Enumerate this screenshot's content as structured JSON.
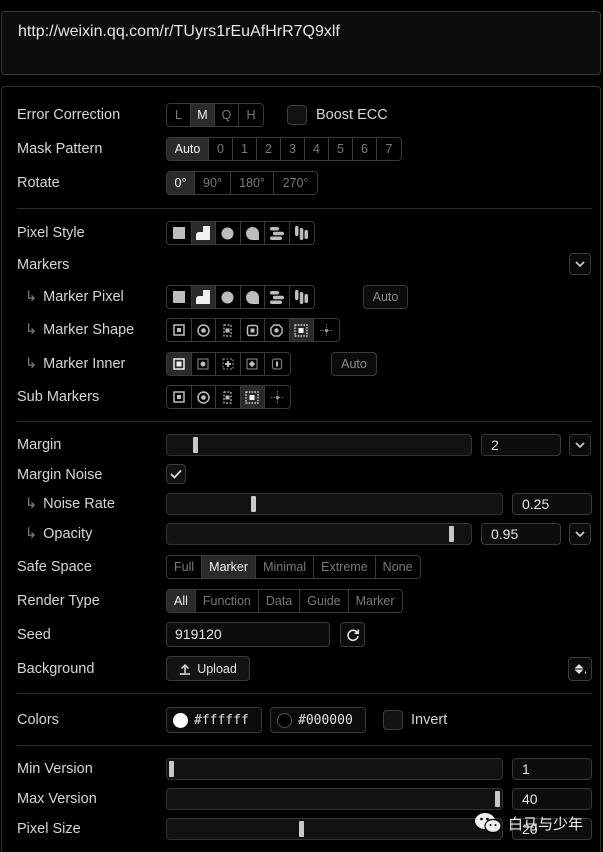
{
  "url": "http://weixin.qq.com/r/TUyrs1rEuAfHrR7Q9xlf",
  "error_correction": {
    "label": "Error Correction",
    "options": [
      "L",
      "M",
      "Q",
      "H"
    ],
    "selected": "M",
    "boost_label": "Boost ECC"
  },
  "mask_pattern": {
    "label": "Mask Pattern",
    "options": [
      "Auto",
      "0",
      "1",
      "2",
      "3",
      "4",
      "5",
      "6",
      "7"
    ],
    "selected": "Auto"
  },
  "rotate": {
    "label": "Rotate",
    "options": [
      "0°",
      "90°",
      "180°",
      "270°"
    ],
    "selected": "0°"
  },
  "pixel_style": {
    "label": "Pixel Style",
    "options": [
      "square-icon",
      "rounded-corner-icon",
      "dot-icon",
      "squircle-icon",
      "row-icon",
      "column-icon"
    ],
    "selected_index": 1
  },
  "markers": {
    "label": "Markers"
  },
  "marker_pixel": {
    "label": "Marker Pixel",
    "auto_label": "Auto",
    "selected_index": 1
  },
  "marker_shape": {
    "label": "Marker Shape",
    "selected_index": 5
  },
  "marker_inner": {
    "label": "Marker Inner",
    "auto_label": "Auto",
    "selected_index": 0
  },
  "sub_markers": {
    "label": "Sub Markers",
    "selected_index": 3
  },
  "margin": {
    "label": "Margin",
    "value": "2",
    "level": 0.08
  },
  "margin_noise": {
    "label": "Margin Noise",
    "checked": true
  },
  "noise_rate": {
    "label": "Noise Rate",
    "value": "0.25",
    "level": 0.25
  },
  "opacity": {
    "label": "Opacity",
    "value": "0.95",
    "level": 0.95
  },
  "safe_space": {
    "label": "Safe Space",
    "options": [
      "Full",
      "Marker",
      "Minimal",
      "Extreme",
      "None"
    ],
    "selected": "Marker"
  },
  "render_type": {
    "label": "Render Type",
    "options": [
      "All",
      "Function",
      "Data",
      "Guide",
      "Marker"
    ],
    "selected": "All"
  },
  "seed": {
    "label": "Seed",
    "value": "919120"
  },
  "background": {
    "label": "Background",
    "upload_label": "Upload"
  },
  "colors": {
    "label": "Colors",
    "light": "#ffffff",
    "dark": "#000000",
    "invert_label": "Invert"
  },
  "min_version": {
    "label": "Min Version",
    "value": "1",
    "level": 0.0
  },
  "max_version": {
    "label": "Max Version",
    "value": "40",
    "level": 1.0
  },
  "pixel_size": {
    "label": "Pixel Size",
    "value": "20",
    "level": 0.4
  },
  "watermark": {
    "text": "白马与少年"
  }
}
